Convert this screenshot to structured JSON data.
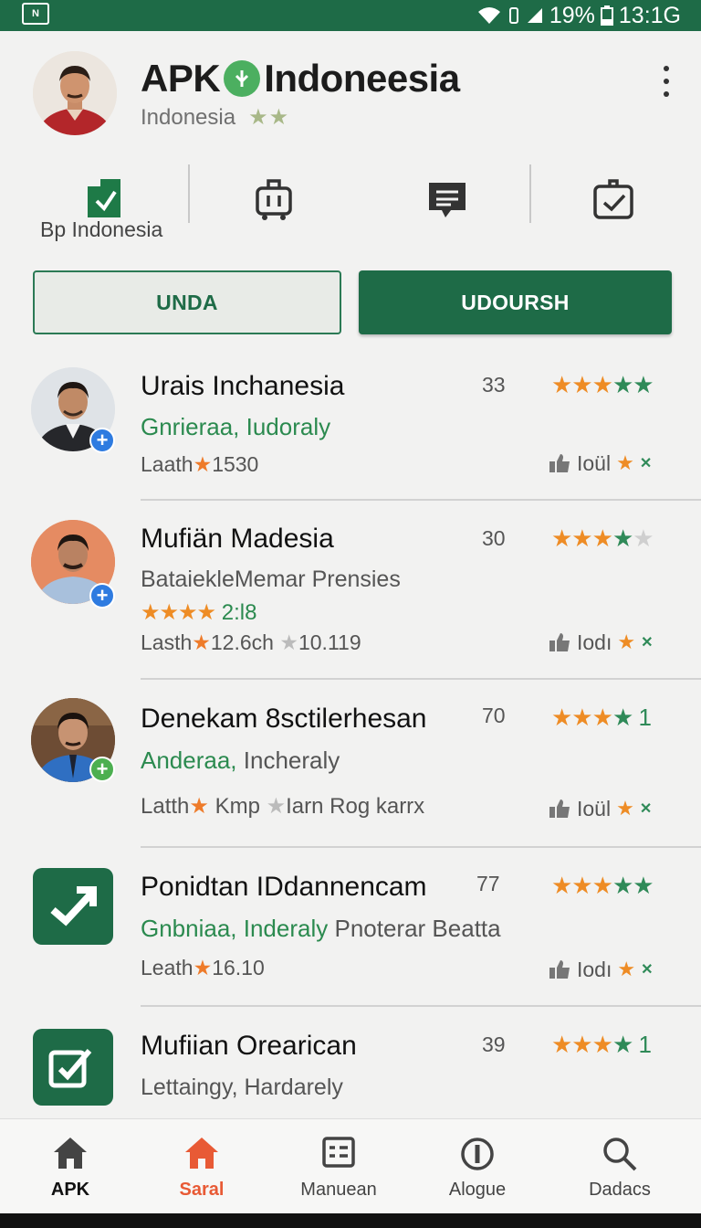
{
  "status_bar": {
    "battery": "19%",
    "time": "13:1G",
    "notif_icon_text": "N"
  },
  "header": {
    "title_left": "APK",
    "title_right": "Indoneesia",
    "subtitle": "Indonesia",
    "subtitle_stars": "★★"
  },
  "quick_actions": {
    "first_label": "Bp Indonesia"
  },
  "buttons": {
    "outline_label": "UNDA",
    "filled_label": "UDOURSH"
  },
  "list": [
    {
      "title": "Urais Inchanesia",
      "line2_green": "Gnrieraa, Iudoraly",
      "line2_gray": "",
      "meta_prefix": "Laath",
      "meta_value": "1530",
      "meta_extra": "",
      "count": "33",
      "rating_stars": {
        "orange": "★★★",
        "green": "★★",
        "light": ""
      },
      "side_label": "Ioül"
    },
    {
      "title": "Mufiän Madesia",
      "line2_green": "",
      "line2_gray": "BataiekleMemar Prensies",
      "extra_stars": "★★★★",
      "extra_value": "2:l8",
      "meta_prefix": "Lasth",
      "meta_value": "12.6ch",
      "meta_extra": "10.119",
      "count": "30",
      "rating_stars": {
        "orange": "★★★",
        "green": "★",
        "light": "★"
      },
      "side_label": "Iodı"
    },
    {
      "title": "Denekam 8sctilerhesan",
      "line2_green": "Anderaa,",
      "line2_gray": "Incheraly",
      "meta_prefix": "Latth",
      "meta_value": "Kmp",
      "meta_extra": "Iarn Rog karrx",
      "count": "70",
      "rating_stars": {
        "orange": "★★★",
        "green": "★",
        "number": "1"
      },
      "side_label": "Ioül"
    },
    {
      "title": "Ponidtan IDdannencam",
      "line2_green": "Gnbniaa, Inderaly",
      "line2_gray": "Pnoterar Beatta",
      "meta_prefix": "Leath",
      "meta_value": "16.10",
      "meta_extra": "",
      "count": "77",
      "rating_stars": {
        "orange": "★★★",
        "green": "★★",
        "light": ""
      },
      "side_label": "Iodı"
    },
    {
      "title": "Mufiian Orearican",
      "line2_green": "",
      "line2_gray": "Lettaingy, Hardarely",
      "meta_prefix": "",
      "meta_value": "",
      "meta_extra": "",
      "count": "39",
      "rating_stars": {
        "orange": "★★★",
        "green": "★",
        "number": "1"
      },
      "side_label": ""
    }
  ],
  "bottom_nav": [
    {
      "label": "APK",
      "icon": "home-icon"
    },
    {
      "label": "Saral",
      "icon": "home-icon"
    },
    {
      "label": "Manuean",
      "icon": "list-card-icon"
    },
    {
      "label": "Alogue",
      "icon": "info-circle-icon"
    },
    {
      "label": "Dadacs",
      "icon": "search-icon"
    }
  ],
  "colors": {
    "brand_green": "#1e6b47",
    "accent_orange": "#ee8c25",
    "active_nav": "#e85a35"
  }
}
